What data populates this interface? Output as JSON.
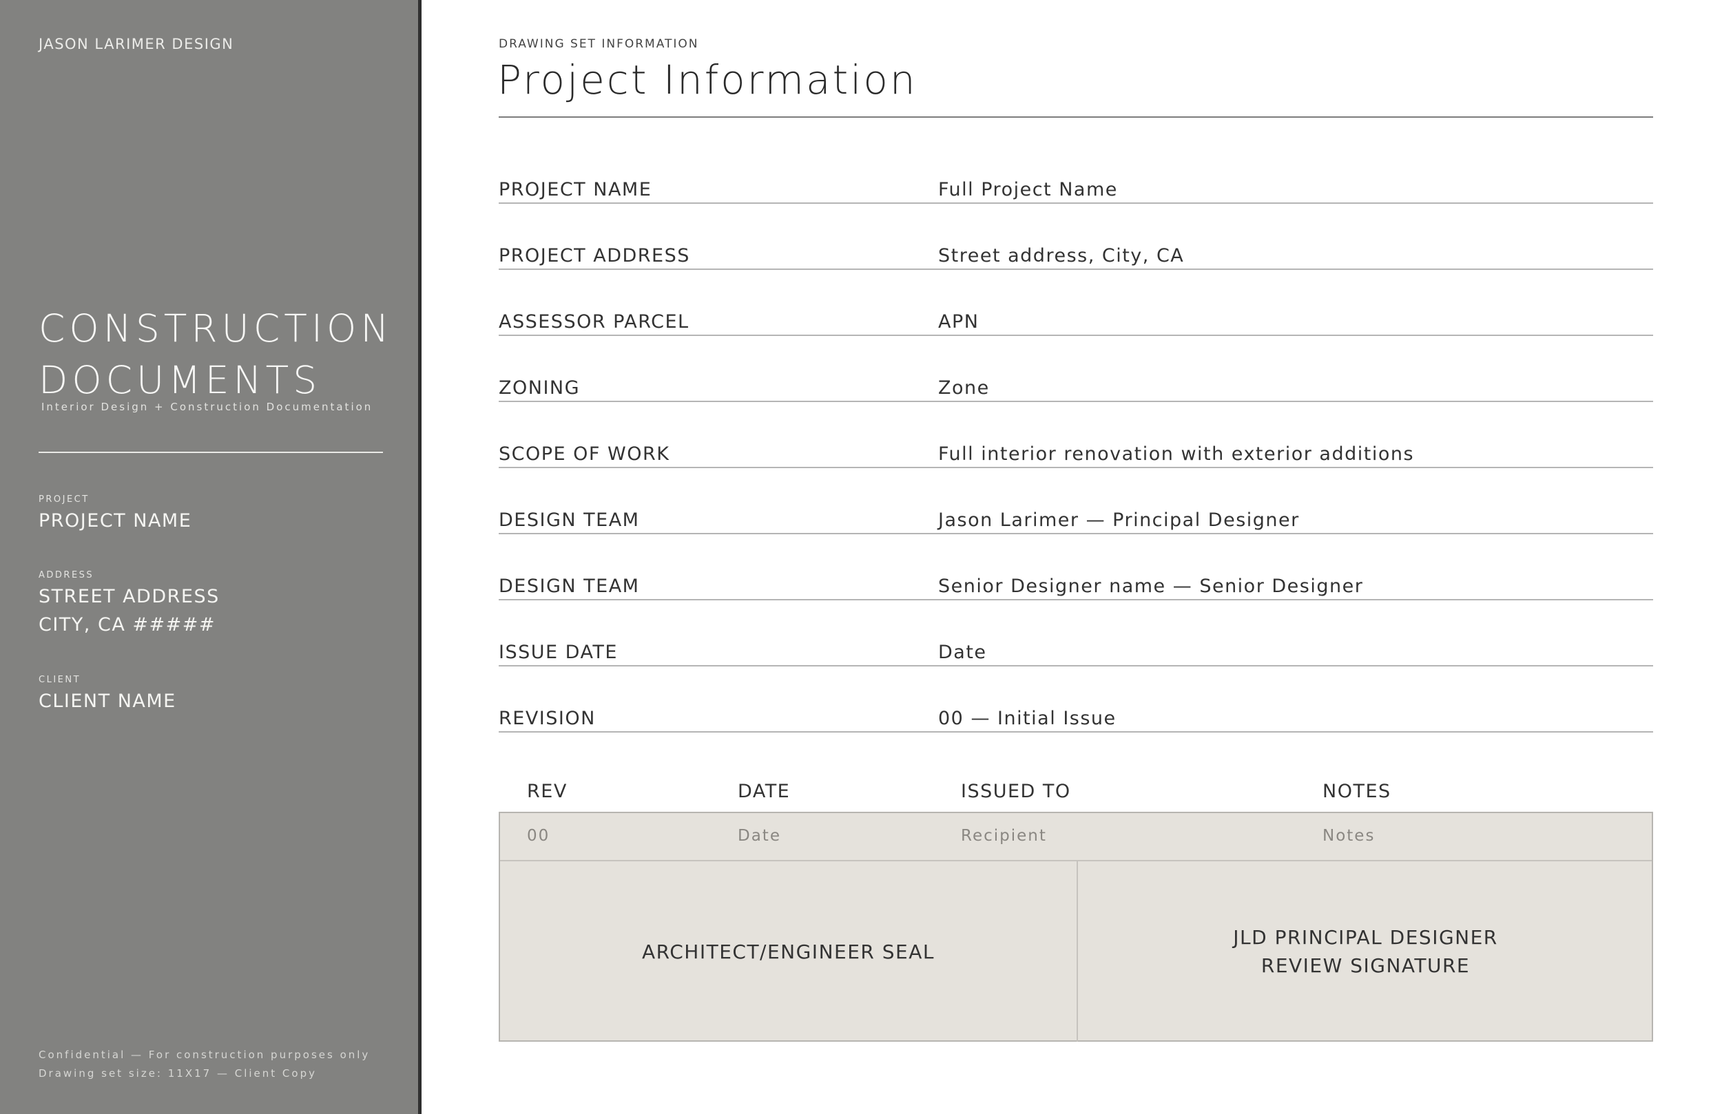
{
  "sidebar": {
    "firm": "JASON LARIMER DESIGN",
    "title_line1": "CONSTRUCTION",
    "title_line2": "DOCUMENTS",
    "subtitle": "Interior Design + Construction Documentation",
    "project_label": "PROJECT",
    "project_value": "PROJECT NAME",
    "address_label": "ADDRESS",
    "address_line1": "STREET ADDRESS",
    "address_line2": "CITY, CA #####",
    "client_label": "CLIENT",
    "client_value": "CLIENT NAME",
    "footer_line1": "Confidential — For construction purposes only",
    "footer_line2": "Drawing set size: 11X17 — Client Copy"
  },
  "main": {
    "kicker": "DRAWING SET INFORMATION",
    "title": "Project Information",
    "rows": [
      {
        "label": "PROJECT NAME",
        "value": "Full Project Name"
      },
      {
        "label": "PROJECT ADDRESS",
        "value": "Street address, City, CA"
      },
      {
        "label": "ASSESSOR PARCEL",
        "value": "APN"
      },
      {
        "label": "ZONING",
        "value": "Zone"
      },
      {
        "label": "SCOPE OF WORK",
        "value": "Full interior renovation with exterior additions"
      },
      {
        "label": "DESIGN TEAM",
        "value": "Jason Larimer — Principal Designer"
      },
      {
        "label": "DESIGN TEAM",
        "value": "Senior Designer name — Senior Designer"
      },
      {
        "label": "ISSUE DATE",
        "value": "Date"
      },
      {
        "label": "REVISION",
        "value": "00 — Initial Issue"
      }
    ],
    "revision_table": {
      "headers": [
        "REV",
        "DATE",
        "ISSUED TO",
        "NOTES"
      ],
      "row": [
        "00",
        "Date",
        "Recipient",
        "Notes"
      ]
    },
    "seal_label": "ARCHITECT/ENGINEER SEAL",
    "signature_line1": "JLD PRINCIPAL DESIGNER",
    "signature_line2": "REVIEW SIGNATURE"
  },
  "colors": {
    "sidebar_bg": "#828280",
    "sidebar_border": "#2f2f2f",
    "box_bg": "#e5e2dc",
    "rule": "#b5b5b5"
  }
}
